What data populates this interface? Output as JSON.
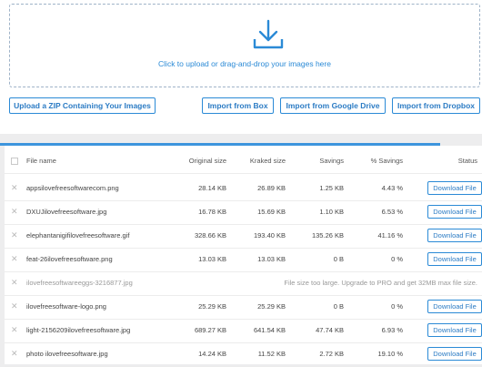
{
  "upload": {
    "prompt": "Click to upload or drag-and-drop your images here",
    "zip_label": "Upload a ZIP Containing Your Images",
    "box_label": "Import from Box",
    "gdrive_label": "Import from Google Drive",
    "dropbox_label": "Import from Dropbox"
  },
  "colors": {
    "accent": "#2b8ad6",
    "tab_bar": "#3d95dd"
  },
  "table": {
    "headers": {
      "file": "File name",
      "original": "Original size",
      "kraked": "Kraked size",
      "savings": "Savings",
      "pct": "% Savings",
      "status": "Status"
    },
    "remove_icon": "close-icon",
    "rows": [
      {
        "name": "appsilovefreesoftwarecom.png",
        "original": "28.14 KB",
        "kraked": "26.89 KB",
        "savings": "1.25 KB",
        "pct": "4.43 %",
        "action": "Download File"
      },
      {
        "name": "DXUJilovefreesoftware.jpg",
        "original": "16.78 KB",
        "kraked": "15.69 KB",
        "savings": "1.10 KB",
        "pct": "6.53 %",
        "action": "Download File"
      },
      {
        "name": "elephantanigifilovefreesoftware.gif",
        "original": "328.66 KB",
        "kraked": "193.40 KB",
        "savings": "135.26 KB",
        "pct": "41.16 %",
        "action": "Download File"
      },
      {
        "name": "feat-26ilovefreesoftware.png",
        "original": "13.03 KB",
        "kraked": "13.03 KB",
        "savings": "0 B",
        "pct": "0 %",
        "action": "Download File"
      },
      {
        "name": "ilovefreesoftwareeggs-3216877.jpg",
        "error": "File size too large. Upgrade to PRO and get 32MB max file size."
      },
      {
        "name": "ilovefreesoftware-logo.png",
        "original": "25.29 KB",
        "kraked": "25.29 KB",
        "savings": "0 B",
        "pct": "0 %",
        "action": "Download File"
      },
      {
        "name": "light-2156209ilovefreesoftware.jpg",
        "original": "689.27 KB",
        "kraked": "641.54 KB",
        "savings": "47.74 KB",
        "pct": "6.93 %",
        "action": "Download File"
      },
      {
        "name": "photo ilovefreesoftware.jpg",
        "original": "14.24 KB",
        "kraked": "11.52 KB",
        "savings": "2.72 KB",
        "pct": "19.10 %",
        "action": "Download File"
      }
    ]
  }
}
